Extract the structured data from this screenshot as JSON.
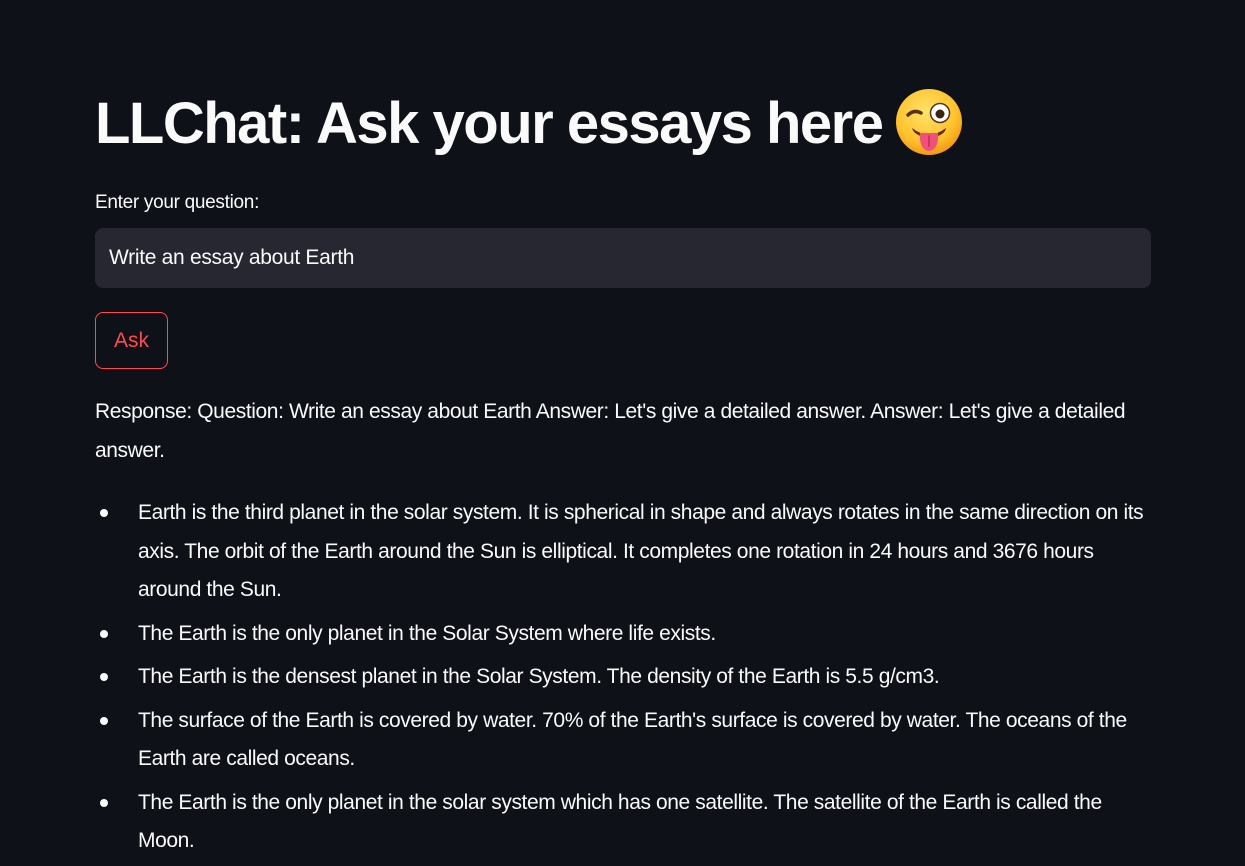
{
  "header": {
    "title": "LLChat: Ask your essays here",
    "emoji_icon": "winking-face-with-tongue-icon"
  },
  "question": {
    "label": "Enter your question:",
    "value": "Write an essay about Earth"
  },
  "ask_button": {
    "label": "Ask"
  },
  "response": {
    "intro": "Response: Question: Write an essay about Earth Answer: Let's give a detailed answer. Answer: Let's give a detailed answer.",
    "bullets": [
      "Earth is the third planet in the solar system. It is spherical in shape and always rotates in the same direction on its axis. The orbit of the Earth around the Sun is elliptical. It completes one rotation in 24 hours and 3676 hours around the Sun.",
      "The Earth is the only planet in the Solar System where life exists.",
      "The Earth is the densest planet in the Solar System. The density of the Earth is 5.5 g/cm3.",
      "The surface of the Earth is covered by water. 70% of the Earth's surface is covered by water. The oceans of the Earth are called oceans.",
      "The Earth is the only planet in the solar system which has one satellite. The satellite of the Earth is called the Moon."
    ]
  },
  "colors": {
    "background": "#0e1117",
    "text": "#fafafa",
    "input_background": "#262730",
    "accent": "#ff4b4b"
  }
}
